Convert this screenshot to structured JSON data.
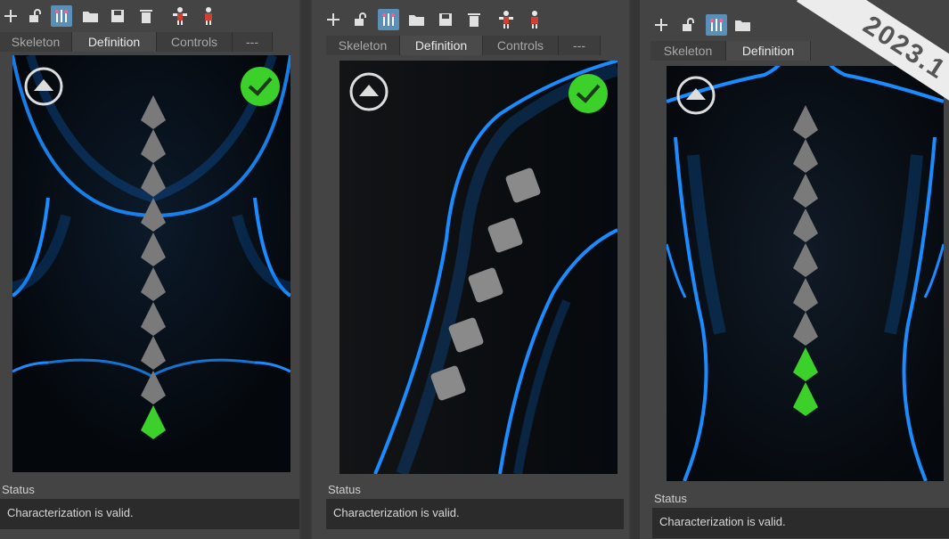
{
  "version_badge": "2023.1",
  "tabs": [
    "Skeleton",
    "Definition",
    "Controls",
    "---"
  ],
  "selected_tab": "Definition",
  "status": {
    "label": "Status",
    "message": "Characterization is valid."
  },
  "toolbar_icons": [
    "add-icon",
    "unlock-icon",
    "mirror-icon",
    "folder-open-icon",
    "save-icon",
    "delete-icon",
    "character-t-pose-icon",
    "character-select-icon"
  ],
  "colors": {
    "accent_blue": "#1a8cff",
    "valid_green": "#3cd12a",
    "joint_gray": "#7a7a7a",
    "active_tool": "#5a8fb8"
  },
  "panels": [
    {
      "name": "spine-neck-view",
      "joints_gray": 9,
      "joints_green": 1,
      "valid": true
    },
    {
      "name": "arm-view",
      "joints_gray": 5,
      "joints_green": 0,
      "valid": true
    },
    {
      "name": "back-view",
      "joints_gray": 7,
      "joints_green": 2,
      "valid": true
    }
  ]
}
